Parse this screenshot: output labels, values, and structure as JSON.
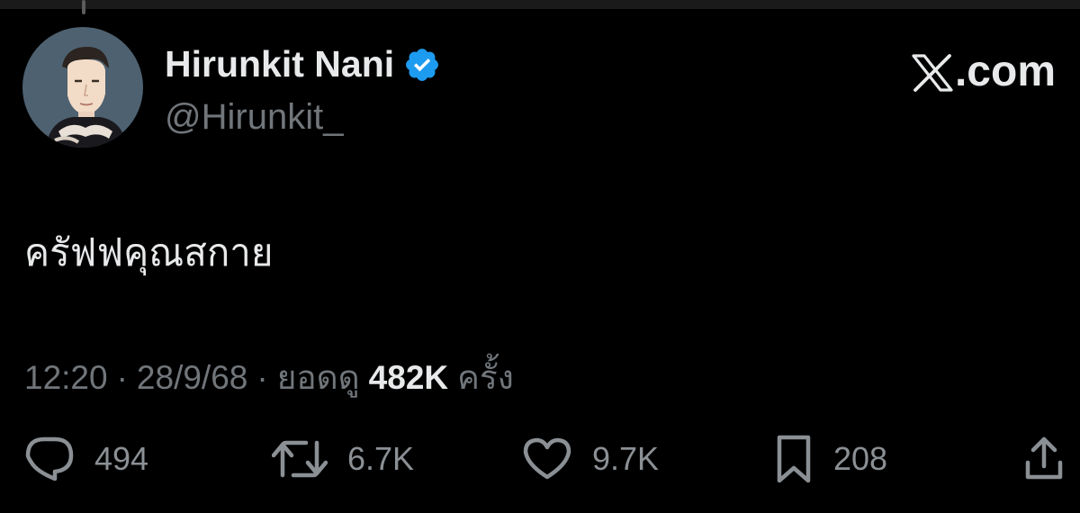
{
  "author": {
    "display_name": "Hirunkit Nani",
    "handle": "@Hirunkit_",
    "verified_icon": "verified-badge-icon",
    "avatar_icon": "profile-avatar"
  },
  "brand": {
    "logo_icon": "x-logo-icon",
    "label": ".com"
  },
  "tweet": {
    "text": "ครัฟฟคุณสกาย"
  },
  "meta": {
    "time": "12:20",
    "separator": "·",
    "date": "28/9/68",
    "views_prefix": "ยอดดู",
    "views_count": "482K",
    "views_suffix": "ครั้ง"
  },
  "actions": {
    "reply": {
      "icon": "reply-icon",
      "count": "494"
    },
    "retweet": {
      "icon": "retweet-icon",
      "count": "6.7K"
    },
    "like": {
      "icon": "heart-icon",
      "count": "9.7K"
    },
    "bookmark": {
      "icon": "bookmark-icon",
      "count": "208"
    },
    "share": {
      "icon": "share-icon"
    }
  },
  "colors": {
    "background": "#000000",
    "primary_text": "#e7e9ea",
    "secondary_text": "#71767b",
    "verified_blue": "#1d9bf0",
    "avatar_bg": "#4e6170"
  }
}
